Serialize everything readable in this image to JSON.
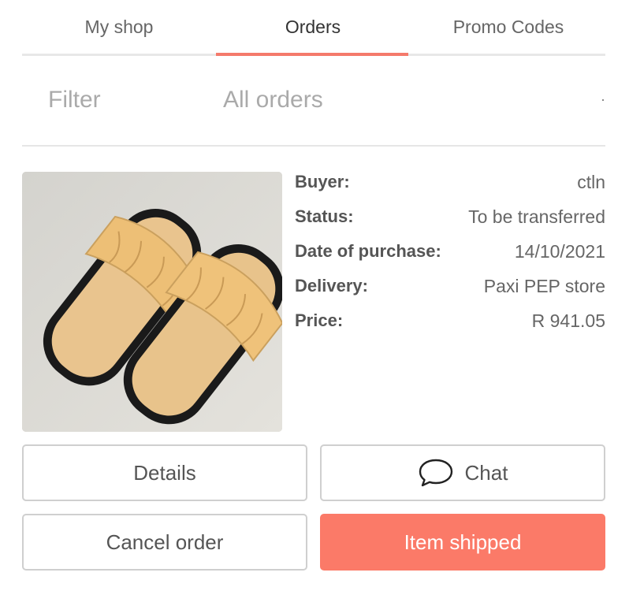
{
  "tabs": [
    {
      "label": "My shop"
    },
    {
      "label": "Orders"
    },
    {
      "label": "Promo Codes"
    }
  ],
  "filter": {
    "label": "Filter",
    "value": "All orders"
  },
  "order": {
    "image_icon": "sandals-photo",
    "fields": [
      {
        "label": "Buyer:",
        "value": "ctln"
      },
      {
        "label": "Status:",
        "value": "To be transferred"
      },
      {
        "label": "Date of purchase:",
        "value": "14/10/2021"
      },
      {
        "label": "Delivery:",
        "value": "Paxi PEP store"
      },
      {
        "label": "Price:",
        "value": "R 941.05"
      }
    ]
  },
  "actions": {
    "details_label": "Details",
    "chat_label": "Chat",
    "chat_icon": "speech-bubble-icon",
    "cancel_label": "Cancel order",
    "shipped_label": "Item shipped"
  },
  "colors": {
    "accent": "#f47a6b",
    "primary_button": "#fb7a68"
  }
}
